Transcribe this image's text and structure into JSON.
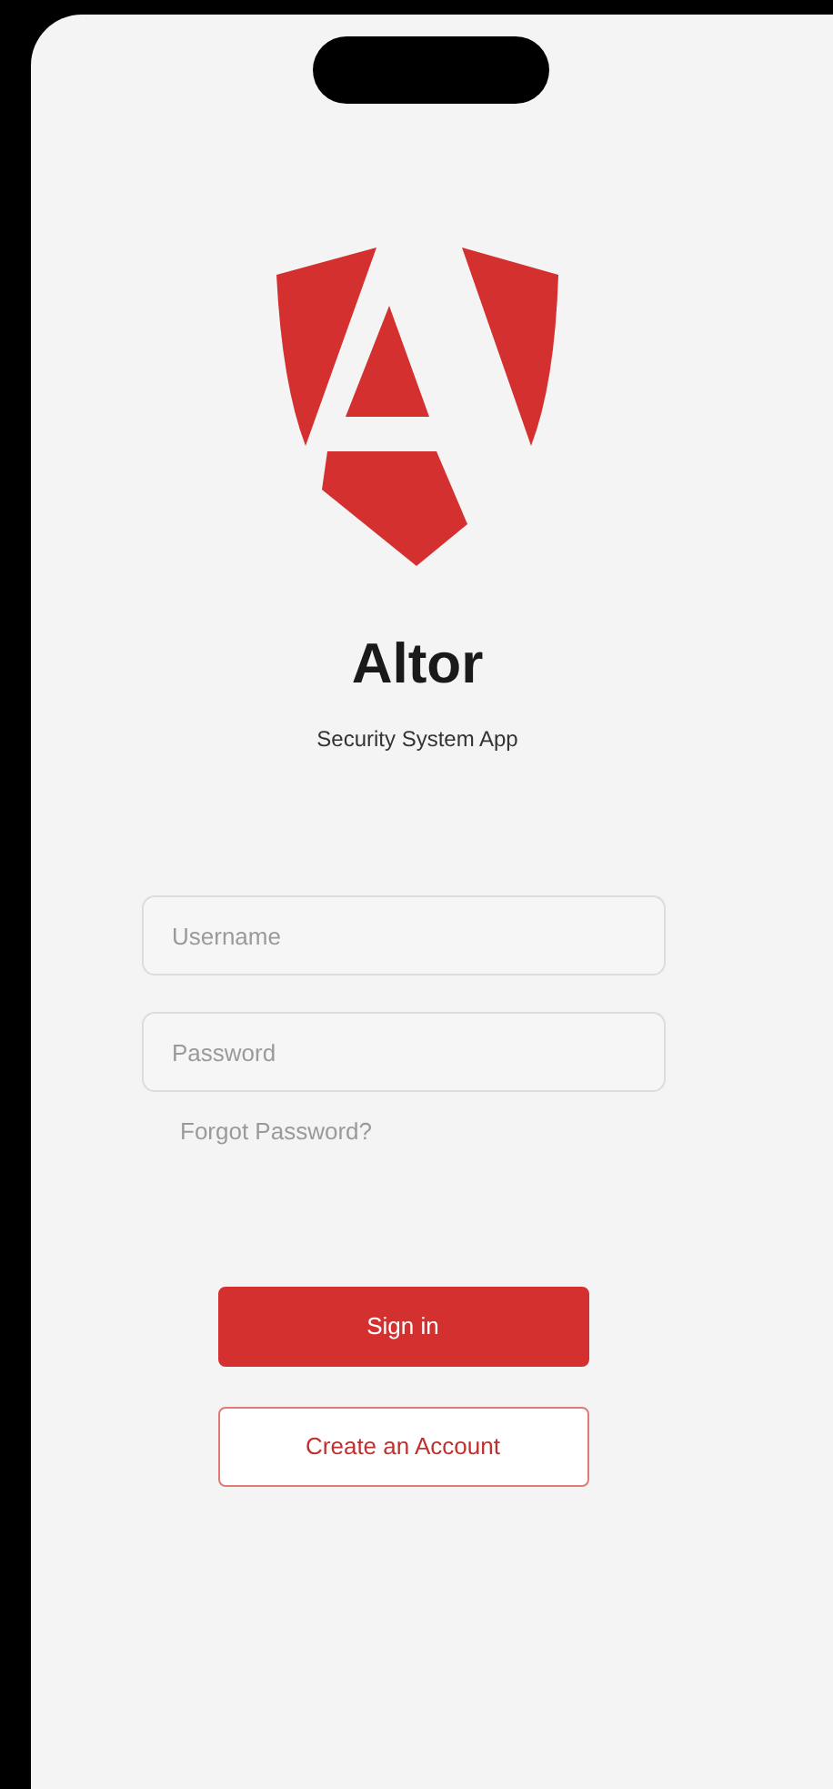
{
  "app": {
    "title": "Altor",
    "subtitle": "Security System App"
  },
  "fields": [
    {
      "placeholder": "Username"
    },
    {
      "placeholder": "Password"
    }
  ],
  "forgot_link": "Forgot Password?",
  "buttons": [
    {
      "label": "Sign in",
      "kind": "primary"
    },
    {
      "label": "Create an Account",
      "kind": "outline"
    }
  ]
}
